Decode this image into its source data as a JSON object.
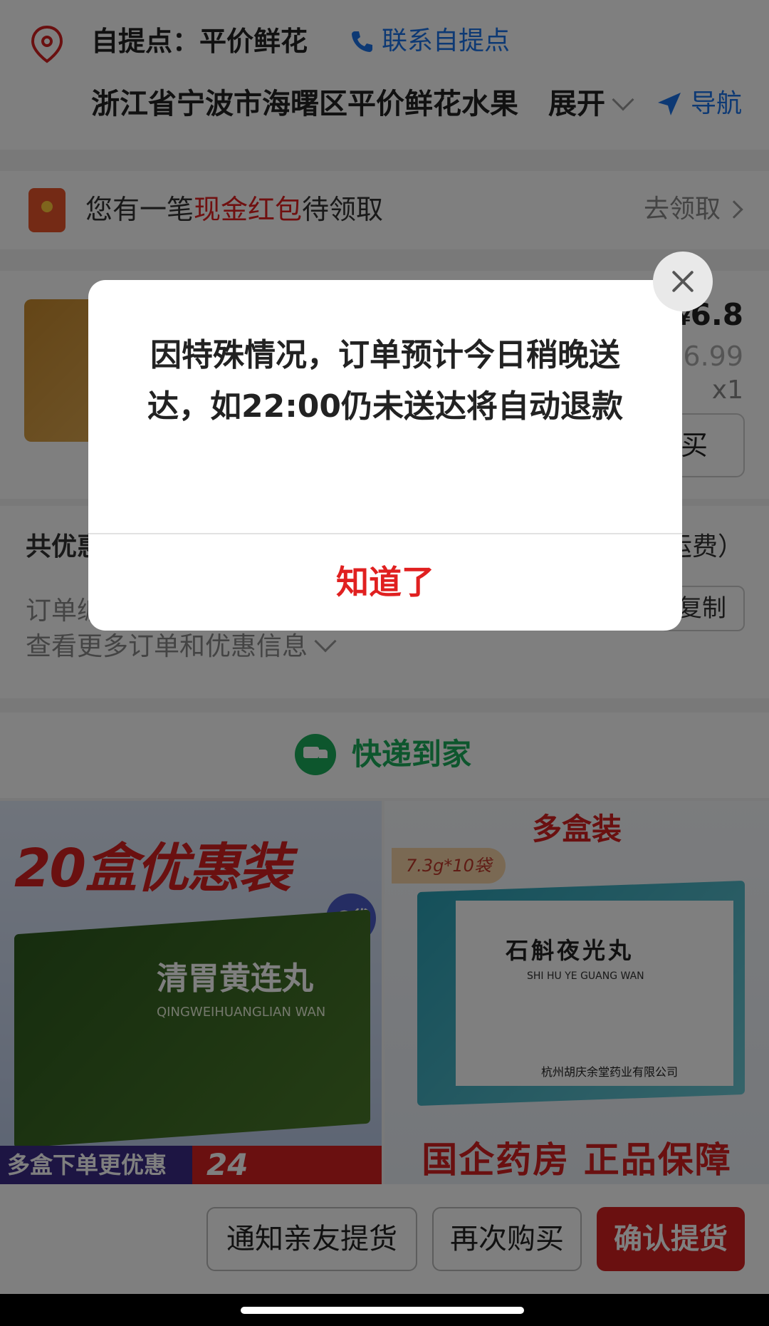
{
  "pickup": {
    "name": "自提点：平价鲜花",
    "contact_label": "联系自提点",
    "address": "浙江省宁波市海曙区平价鲜花水果",
    "expand_label": "展开",
    "nav_label": "导航"
  },
  "red_packet": {
    "prefix": "您有一笔",
    "highlight": "现金红包",
    "suffix": "待领取",
    "action": "去领取"
  },
  "product": {
    "price_symbol": "¥",
    "price": "6.8",
    "original_price": "6.99",
    "quantity": "x1",
    "rebuy_label": "购买"
  },
  "summary": {
    "discount_label": "共优惠",
    "shipping_note": "运费）",
    "order_label": "订单编",
    "copy_label": "复制",
    "more_label": "查看更多订单和优惠信息"
  },
  "express": {
    "label": "快递到家"
  },
  "banners": {
    "left": {
      "headline": "20盒优惠装",
      "bag_badge": "6袋",
      "product_name": "清胃黄连丸",
      "product_pinyin": "QINGWEIHUANGLIAN WAN",
      "footer_left": "多盒下单更优惠",
      "footer_right": "24"
    },
    "right": {
      "top_label": "多盒装",
      "spec_tag": "7.3g*10袋",
      "product_name": "石斛夜光丸",
      "product_pinyin": "SHI HU YE GUANG WAN",
      "company": "杭州胡庆余堂药业有限公司",
      "footer": "国企药房 正品保障"
    }
  },
  "bottom_bar": {
    "notify_label": "通知亲友提货",
    "rebuy_label": "再次购买",
    "confirm_label": "确认提货"
  },
  "dialog": {
    "message": "因特殊情况，订单预计今日稍晚送达，如22:00仍未送达将自动退款",
    "ok_label": "知道了"
  },
  "colors": {
    "accent_red": "#d42020",
    "link_blue": "#1a73e8",
    "express_green": "#1aad5a"
  }
}
